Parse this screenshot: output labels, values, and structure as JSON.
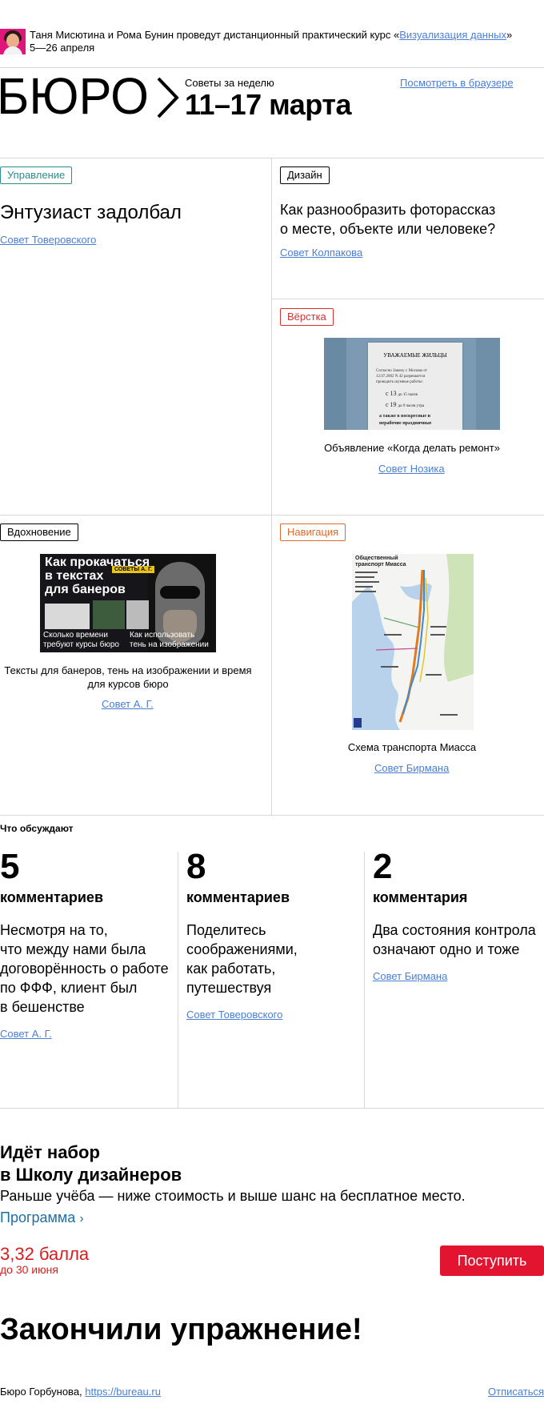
{
  "promo": {
    "text_before": "Таня Мисютина и Рома Бунин проведут дистанционный практический курс «",
    "course_link": "Визуализация данных",
    "text_after": "»",
    "dates": "5—26 апреля"
  },
  "header": {
    "logo_text": "БЮРО",
    "subtitle": "Советы за неделю",
    "title": "11–17 марта",
    "browser_link": "Посмотреть в браузере"
  },
  "cards": {
    "management": {
      "tag": "Управление",
      "title": "Энтузиаст задолбал",
      "link": "Совет Товеровского"
    },
    "design": {
      "tag": "Дизайн",
      "title_line1": "Как разнообразить фоторассказ",
      "title_line2": "о месте, объекте или человеке?",
      "link": "Совет Колпакова"
    },
    "layout": {
      "tag": "Вёрстка",
      "image": {
        "heading": "УВАЖАЕМЫЕ ЖИЛЬЦЫ",
        "line1": "Согласно Закону г. Москвы от",
        "line2": "12.07.2002 N 42 разрешается",
        "line3": "проводить шумные работы:",
        "line4a": "с 13",
        "line4b": "до 15 часов",
        "line5a": "с 19",
        "line5b": "до 9 часов утра",
        "line6": "а также в воскресные и",
        "line7": "нерабочие праздничные"
      },
      "caption": "Объявление «Когда делать ремонт»",
      "link": "Совет Нозика"
    },
    "inspiration": {
      "tag": "Вдохновение",
      "image": {
        "line1": "Как прокачаться",
        "line2": "в текстах",
        "line3": "для банеров",
        "badge": "СОВЕТЫ А. Г.",
        "bottom_left_1": "Сколько времени",
        "bottom_left_2": "требуют курсы бюро",
        "bottom_right_1": "Как использовать",
        "bottom_right_2": "тень на изображении"
      },
      "caption_line1": "Тексты для банеров, тень на изображении и время",
      "caption_line2": "для курсов бюро",
      "link": "Совет А. Г."
    },
    "navigation": {
      "tag": "Навигация",
      "image": {
        "title_1": "Общественный",
        "title_2": "транспорт Миасса"
      },
      "caption": "Схема транспорта Миасса",
      "link": "Совет Бирмана"
    }
  },
  "discussions": {
    "heading": "Что обсуждают",
    "items": [
      {
        "count": "5",
        "unit": "комментариев",
        "text_lines": [
          "Несмотря на то,",
          "что между нами была",
          "договорённость о работе",
          "по ФФФ, клиент был",
          "в бешенстве"
        ],
        "link": "Совет А. Г."
      },
      {
        "count": "8",
        "unit": "комментариев",
        "text_lines": [
          "Поделитесь",
          "соображениями,",
          "как работать,",
          "путешествуя"
        ],
        "link": "Совет Товеровского"
      },
      {
        "count": "2",
        "unit": "комментария",
        "text_lines": [
          "Два состояния контрола",
          "означают одно и тоже"
        ],
        "link": "Совет Бирмана"
      }
    ]
  },
  "school": {
    "heading_line1": "Идёт набор",
    "heading_line2": "в Школу дизайнеров",
    "subtitle": "Раньше учёба — ниже стоимость и выше шанс на бесплатное место.",
    "program_link": "Программа",
    "price": "3,32 балла",
    "deadline": "до 30 июня",
    "apply_button": "Поступить"
  },
  "footer": {
    "end_title": "Закончили упражнение!",
    "brand": "Бюро Горбунова,",
    "site": "https://bureau.ru",
    "unsubscribe": "Отписаться"
  },
  "colors": {
    "link": "#4a7fd4",
    "teal": "#2a8f8f",
    "red": "#d93030",
    "orange": "#e06a2a",
    "button": "#e3142f"
  }
}
